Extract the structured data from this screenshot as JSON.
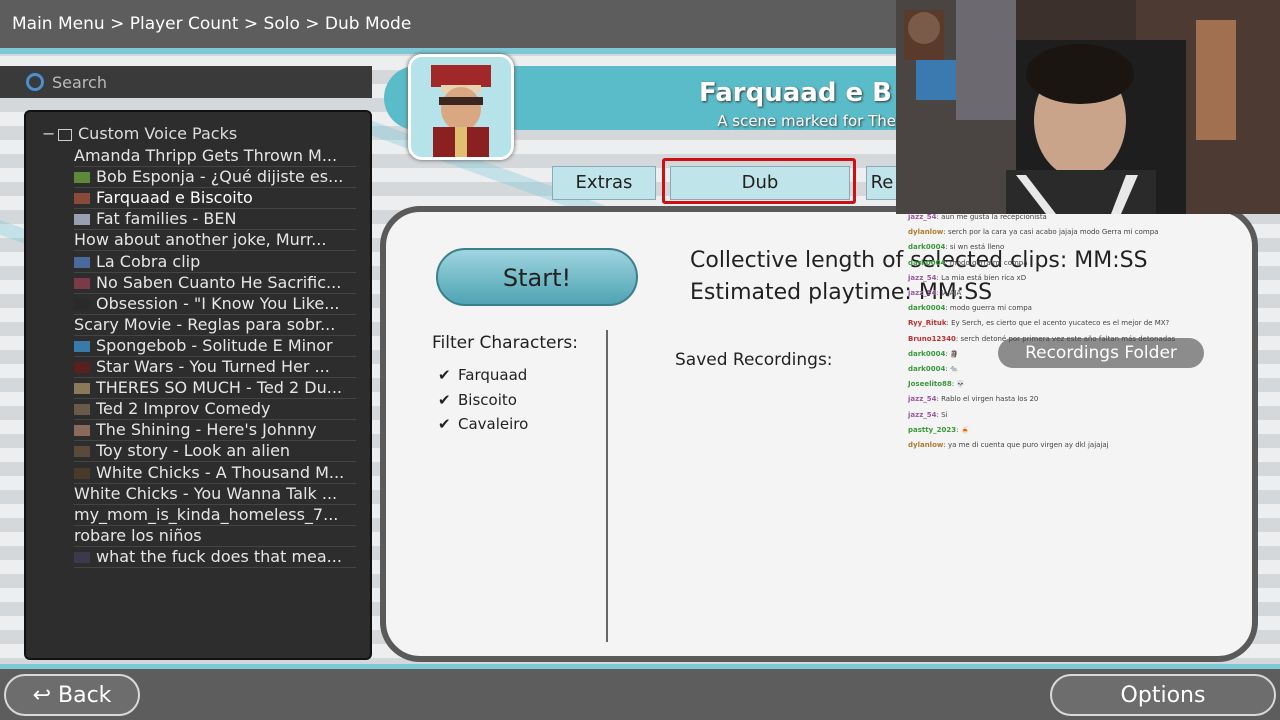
{
  "breadcrumb": "Main Menu > Player Count > Solo > Dub Mode",
  "search": {
    "placeholder": "Search"
  },
  "tree": {
    "root_label": "Custom Voice Packs",
    "root_sign": "−",
    "items": [
      {
        "label": "Amanda Thripp Gets Thrown M...",
        "thumb": false
      },
      {
        "label": "Bob Esponja - ¿Qué dijiste es...",
        "thumb": true,
        "color": "#5c8a3a"
      },
      {
        "label": "Farquaad e Biscoito",
        "thumb": true,
        "color": "#8a4a3a",
        "selected": true
      },
      {
        "label": "Fat families - BEN",
        "thumb": true,
        "color": "#9aa0b0"
      },
      {
        "label": "How about another joke, Murr...",
        "thumb": false
      },
      {
        "label": "La Cobra clip",
        "thumb": true,
        "color": "#4a6a9a"
      },
      {
        "label": "No Saben Cuanto He Sacrific...",
        "thumb": true,
        "color": "#7a3a4a"
      },
      {
        "label": "Obsession - \"I Know You Like...",
        "thumb": true,
        "color": "#2a2a2a"
      },
      {
        "label": "Scary Movie - Reglas para sobr...",
        "thumb": false
      },
      {
        "label": "Spongebob - Solitude E Minor",
        "thumb": true,
        "color": "#3a7aaa"
      },
      {
        "label": "Star Wars - You Turned Her ...",
        "thumb": true,
        "color": "#5a2020"
      },
      {
        "label": "THERES SO MUCH - Ted 2 Du...",
        "thumb": true,
        "color": "#8a7a5a"
      },
      {
        "label": "Ted 2 Improv Comedy",
        "thumb": true,
        "color": "#6a5a4a"
      },
      {
        "label": "The Shining - Here's Johnny",
        "thumb": true,
        "color": "#8a6a5a"
      },
      {
        "label": "Toy story - Look an alien",
        "thumb": true,
        "color": "#5a4a3a"
      },
      {
        "label": "White Chicks - A Thousand M...",
        "thumb": true,
        "color": "#4a3a2a"
      },
      {
        "label": "White Chicks - You Wanna Talk ...",
        "thumb": false
      },
      {
        "label": "my_mom_is_kinda_homeless_7...",
        "thumb": false,
        "plus": "+"
      },
      {
        "label": "robare los niños",
        "thumb": false
      },
      {
        "label": "what the fuck does that mea...",
        "thumb": true,
        "color": "#3a3a4a"
      }
    ]
  },
  "banner": {
    "title": "Farquaad e B",
    "subtitle": "A scene marked for The"
  },
  "tabs": {
    "extras": "Extras",
    "dub": "Dub",
    "re": "Re"
  },
  "main": {
    "start_label": "Start!",
    "collective_length": "Collective length of selected clips: MM:SS",
    "estimated_playtime": "Estimated playtime: MM:SS",
    "filter_label": "Filter Characters:",
    "check_glyph": "✔",
    "characters": [
      "Farquaad",
      "Biscoito",
      "Cavaleiro"
    ],
    "saved_label": "Saved Recordings:",
    "recordings_folder": "Recordings Folder"
  },
  "chat": [
    {
      "user": "jazz_54",
      "msg": ": aun me gusta la recepcionista",
      "color": "#9a5aa0"
    },
    {
      "user": "dylanlow",
      "msg": ": serch por la cara ya casi acabo jajaja modo Gerra mi compa",
      "color": "#b07a30"
    },
    {
      "user": "dark0004",
      "msg": ": si wn está lleno",
      "color": "#3a9a3a"
    },
    {
      "user": "dark0004",
      "msg": ": modo gerra mi compa",
      "color": "#3a9a3a"
    },
    {
      "user": "jazz_54",
      "msg": ": La mia está bien rica xD",
      "color": "#9a5aa0"
    },
    {
      "user": "jazz_54",
      "msg": ": JAJAJA",
      "color": "#9a5aa0"
    },
    {
      "user": "dark0004",
      "msg": ": modo guerra mi compa",
      "color": "#3a9a3a"
    },
    {
      "user": "Ryy_Rituk",
      "msg": ": Ey Serch, es cierto que el acento yucateco es el mejor de MX?",
      "color": "#c03030"
    },
    {
      "user": "Bruno12340",
      "msg": ": serch detoné por primera vez este año faltan más detonadas",
      "color": "#c03030"
    },
    {
      "user": "dark0004",
      "msg": ": 🗿",
      "color": "#3a9a3a"
    },
    {
      "user": "dark0004",
      "msg": ": 🐀",
      "color": "#3a9a3a"
    },
    {
      "user": "Joseelito88",
      "msg": ": 💀",
      "color": "#3a9a3a"
    },
    {
      "user": "jazz_54",
      "msg": ": Rablo el virgen hasta los 20",
      "color": "#9a5aa0"
    },
    {
      "user": "jazz_54",
      "msg": ": Si",
      "color": "#9a5aa0"
    },
    {
      "user": "pastty_2023",
      "msg": ": 🍝",
      "color": "#3a9a3a"
    },
    {
      "user": "dylanlow",
      "msg": ": ya me di cuenta que puro virgen ay dkl jajajaj",
      "color": "#b07a30"
    }
  ],
  "bottom": {
    "back_label": "↩ Back",
    "options_label": "Options"
  }
}
